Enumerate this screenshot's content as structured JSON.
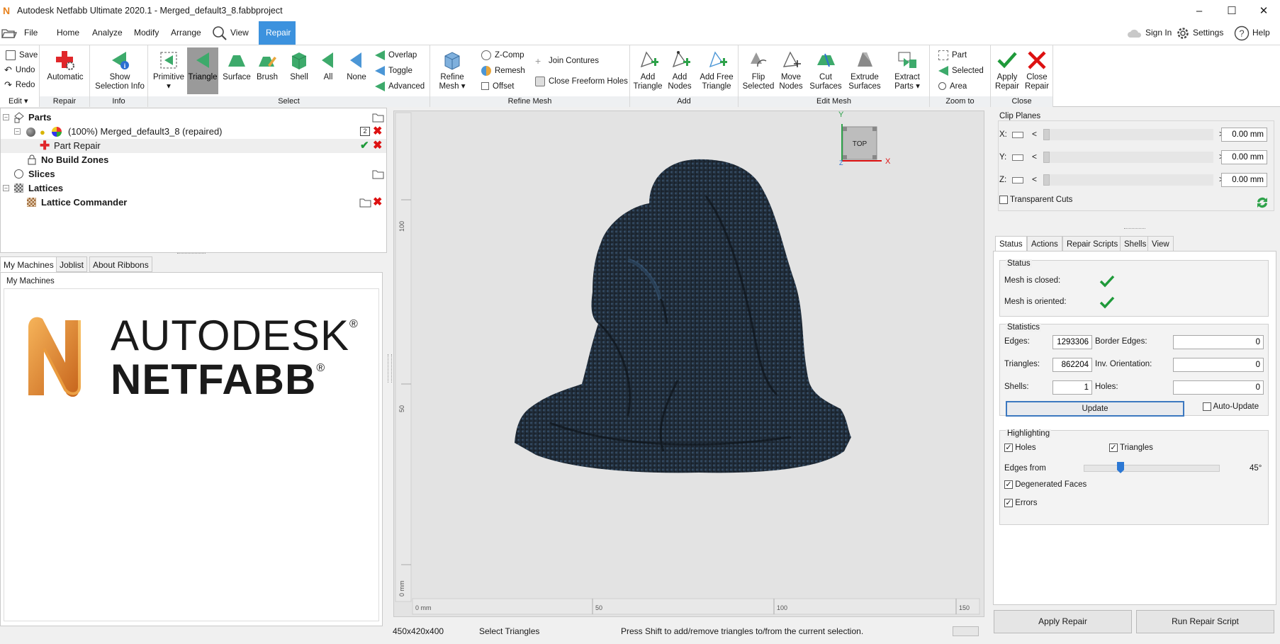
{
  "window": {
    "title": "Autodesk Netfabb Ultimate 2020.1 - Merged_default3_8.fabbproject",
    "app_icon": "N"
  },
  "menu": {
    "file": "File",
    "home": "Home",
    "analyze": "Analyze",
    "modify": "Modify",
    "arrange": "Arrange",
    "view": "View",
    "repair": "Repair",
    "sign_in": "Sign In",
    "settings": "Settings",
    "help": "Help"
  },
  "ribbon": {
    "edit": {
      "save": "Save",
      "undo": "Undo",
      "redo": "Redo",
      "label": "Edit ▾"
    },
    "repair": {
      "automatic": "Automatic",
      "label": "Repair"
    },
    "info": {
      "show_selection_info_1": "Show",
      "show_selection_info_2": "Selection Info",
      "label": "Info"
    },
    "select": {
      "primitive": "Primitive",
      "triangle": "Triangle",
      "surface": "Surface",
      "brush": "Brush",
      "shell": "Shell",
      "all": "All",
      "none": "None",
      "overlap": "Overlap",
      "toggle": "Toggle",
      "advanced": "Advanced",
      "label": "Select"
    },
    "refine_mesh": {
      "refine_mesh_1": "Refine",
      "refine_mesh_2": "Mesh ▾",
      "zcomp": "Z-Comp",
      "remesh": "Remesh",
      "offset": "Offset",
      "join_contures": "Join Contures",
      "close_freeform_holes": "Close Freeform Holes",
      "label": "Refine Mesh"
    },
    "add": {
      "add_triangle_1": "Add",
      "add_triangle_2": "Triangle",
      "add_nodes_1": "Add",
      "add_nodes_2": "Nodes",
      "add_free_1": "Add Free",
      "add_free_2": "Triangle",
      "label": "Add"
    },
    "edit_mesh": {
      "flip_1": "Flip",
      "flip_2": "Selected",
      "move_1": "Move",
      "move_2": "Nodes",
      "cut_1": "Cut",
      "cut_2": "Surfaces",
      "extrude_1": "Extrude",
      "extrude_2": "Surfaces",
      "extract_1": "Extract",
      "extract_2": "Parts ▾",
      "label": "Edit Mesh"
    },
    "zoom_to": {
      "part": "Part",
      "selected": "Selected",
      "area": "Area",
      "label": "Zoom to"
    },
    "close": {
      "apply_1": "Apply",
      "apply_2": "Repair",
      "close_1": "Close",
      "close_2": "Repair",
      "label": "Close"
    }
  },
  "tree": {
    "parts": "Parts",
    "merged": "(100%) Merged_default3_8 (repaired)",
    "merged_badge": "2",
    "part_repair": "Part Repair",
    "no_build_zones": "No Build Zones",
    "slices": "Slices",
    "lattices": "Lattices",
    "lattice_commander": "Lattice Commander"
  },
  "lower_tabs": {
    "my_machines": "My Machines",
    "joblist": "Joblist",
    "about_ribbons": "About Ribbons",
    "group_title": "My Machines",
    "logo_line1": "AUTODESK",
    "logo_line2": "NETFABB",
    "reg": "®"
  },
  "viewport": {
    "cube_label": "TOP",
    "axis_y": "Y",
    "axis_x": "X",
    "axis_z": "Z",
    "ruler_x": [
      "0 mm",
      "50",
      "100",
      "150"
    ],
    "ruler_y": [
      "100",
      "50",
      "0 mm"
    ]
  },
  "clip_planes": {
    "title": "Clip Planes",
    "x_label": "X:",
    "x_value": "0.00 mm",
    "y_label": "Y:",
    "y_value": "0.00 mm",
    "z_label": "Z:",
    "z_value": "0.00 mm",
    "transparent_cuts": "Transparent Cuts"
  },
  "repair_tabs": {
    "status": "Status",
    "actions": "Actions",
    "repair_scripts": "Repair Scripts",
    "shells": "Shells",
    "view": "View"
  },
  "status": {
    "title": "Status",
    "mesh_closed": "Mesh is closed:",
    "mesh_oriented": "Mesh is oriented:"
  },
  "statistics": {
    "title": "Statistics",
    "edges_label": "Edges:",
    "edges": "1293306",
    "triangles_label": "Triangles:",
    "triangles": "862204",
    "shells_label": "Shells:",
    "shells": "1",
    "border_edges_label": "Border Edges:",
    "border_edges": "0",
    "inv_orientation_label": "Inv. Orientation:",
    "inv_orientation": "0",
    "holes_label": "Holes:",
    "holes": "0",
    "update": "Update",
    "auto_update": "Auto-Update"
  },
  "highlighting": {
    "title": "Highlighting",
    "holes": "Holes",
    "triangles": "Triangles",
    "edges_from": "Edges from",
    "edges_from_value": "45°",
    "edges_from_fraction": 0.25,
    "degenerated_faces": "Degenerated Faces",
    "errors": "Errors"
  },
  "bottom_buttons": {
    "apply_repair": "Apply Repair",
    "run_repair_script": "Run Repair Script"
  },
  "statusbar": {
    "dimensions": "450x420x400",
    "mode": "Select Triangles",
    "hint": "Press Shift to add/remove triangles to/from the current selection."
  },
  "colors": {
    "accent": "#3c92de",
    "check_green": "#1f9a3a",
    "close_red": "#d11111",
    "mesh_dark": "#1e2630",
    "viewport_bg": "#e3e3e3"
  }
}
